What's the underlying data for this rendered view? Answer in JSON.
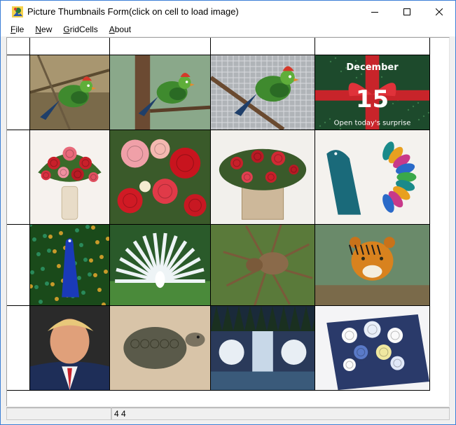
{
  "window": {
    "title": "Picture Thumbnails Form(click on cell to load  image)"
  },
  "menu": {
    "items": [
      {
        "key": "F",
        "rest": "ile"
      },
      {
        "key": "N",
        "rest": "ew"
      },
      {
        "key": "G",
        "rest": "ridCells"
      },
      {
        "key": "A",
        "rest": "bout"
      }
    ]
  },
  "grid": {
    "rows": 4,
    "cols": 4,
    "cells": [
      [
        "turaco-bird-on-branch",
        "turaco-bird-on-tree",
        "turaco-bird-in-cage",
        "december-15-gift-card"
      ],
      [
        "red-rose-bouquet-vase",
        "rose-lily-bouquet",
        "flowers-in-wooden-box",
        "colorful-peacock-art"
      ],
      [
        "blue-peacock-display",
        "white-peacock-display",
        "brown-spider",
        "tiger-on-log"
      ],
      [
        "portrait-man-blue-suit",
        "tortoise-on-sand",
        "waterfall-snow-forest",
        "white-blue-bouquet"
      ]
    ],
    "card": {
      "month": "December",
      "day": "15",
      "caption": "Open today's surprise"
    }
  },
  "status": {
    "panel1": "",
    "panel2": "4 4"
  },
  "colors": {
    "title_bg": "#ffffff",
    "window_border": "#3c7fd6",
    "grid_line": "#000000",
    "chrome": "#f0f0f0"
  }
}
